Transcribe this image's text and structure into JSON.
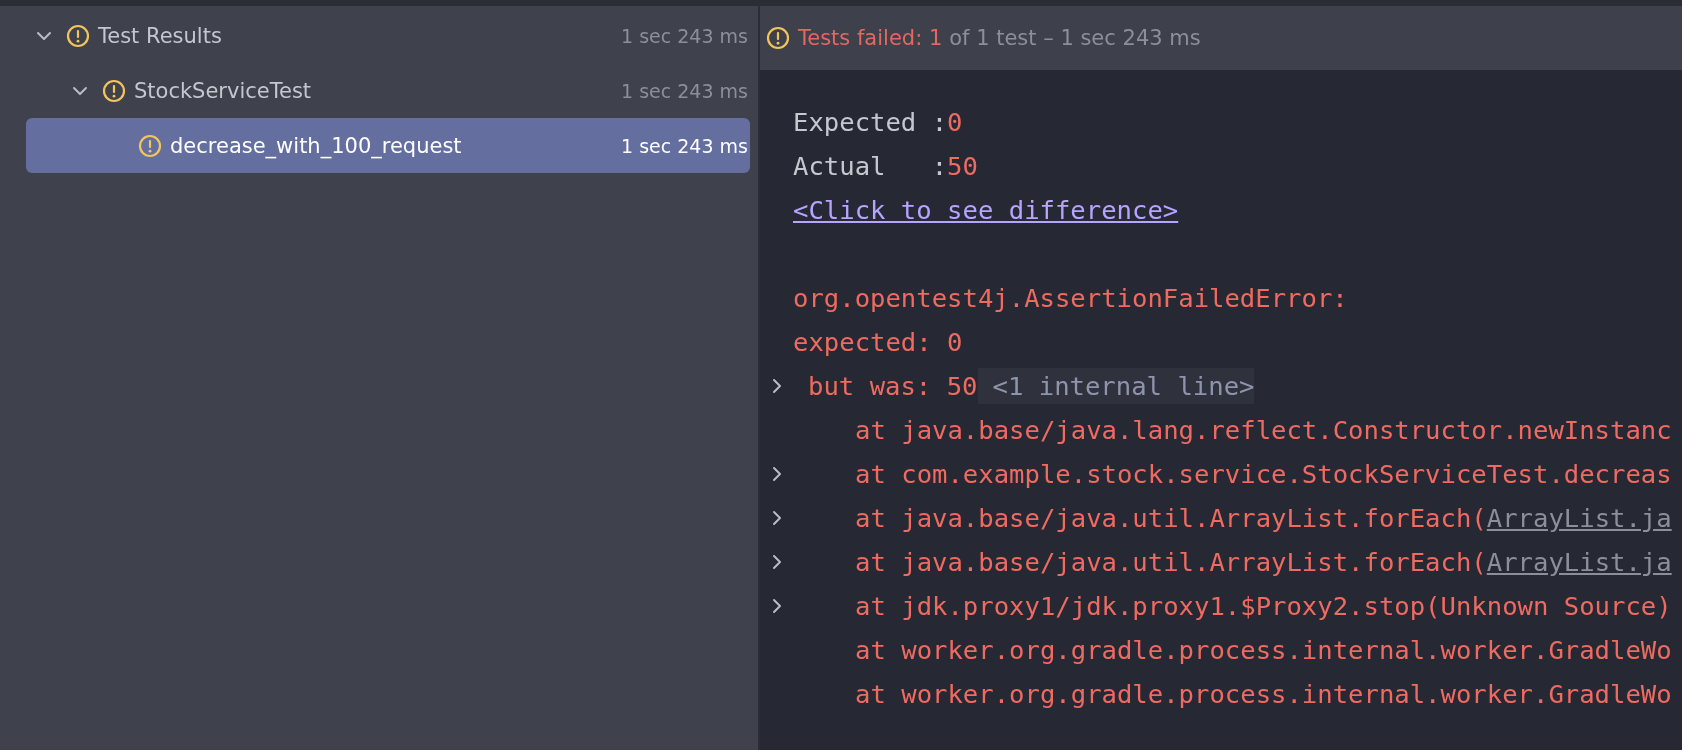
{
  "tree": [
    {
      "label": "Test Results",
      "duration": "1 sec 243 ms",
      "failed": true,
      "expanded": true,
      "selected": false,
      "children": [
        {
          "label": "StockServiceTest",
          "duration": "1 sec 243 ms",
          "failed": true,
          "expanded": true,
          "selected": false,
          "children": [
            {
              "label": "decrease_with_100_request",
              "duration": "1 sec 243 ms",
              "failed": true,
              "selected": true
            }
          ]
        }
      ]
    }
  ],
  "summary": {
    "failed": true,
    "headline": "Tests failed: 1",
    "detail": "of 1 test – 1 sec 243 ms"
  },
  "console": [
    {
      "kind": "comparison",
      "label": "Expected :",
      "value": "0"
    },
    {
      "kind": "comparison",
      "label": "Actual   :",
      "value": "50"
    },
    {
      "kind": "link",
      "text": "<Click to see difference>"
    },
    {
      "kind": "error",
      "text": "org.opentest4j.AssertionFailedError:",
      "gap_before": true
    },
    {
      "kind": "error",
      "text": "expected: 0"
    },
    {
      "kind": "continuation",
      "text": "but was: 50",
      "expandable": true,
      "folded": "<1 internal line>"
    },
    {
      "kind": "trace",
      "text": "at java.base/java.lang.reflect.Constructor.newInstanc",
      "expandable": false
    },
    {
      "kind": "trace",
      "text": "at com.example.stock.service.StockServiceTest.decreas",
      "expandable": true
    },
    {
      "kind": "trace",
      "text": "at java.base/java.util.ArrayList.forEach(",
      "link": "ArrayList.ja",
      "expandable": true
    },
    {
      "kind": "trace",
      "text": "at java.base/java.util.ArrayList.forEach(",
      "link": "ArrayList.ja",
      "expandable": true
    },
    {
      "kind": "trace",
      "text": "at jdk.proxy1/jdk.proxy1.$Proxy2.stop(Unknown Source)",
      "expandable": true
    },
    {
      "kind": "trace",
      "text": "at worker.org.gradle.process.internal.worker.GradleWo",
      "expandable": false
    },
    {
      "kind": "trace",
      "text": "at worker.org.gradle.process.internal.worker.GradleWo",
      "expandable": false
    }
  ]
}
